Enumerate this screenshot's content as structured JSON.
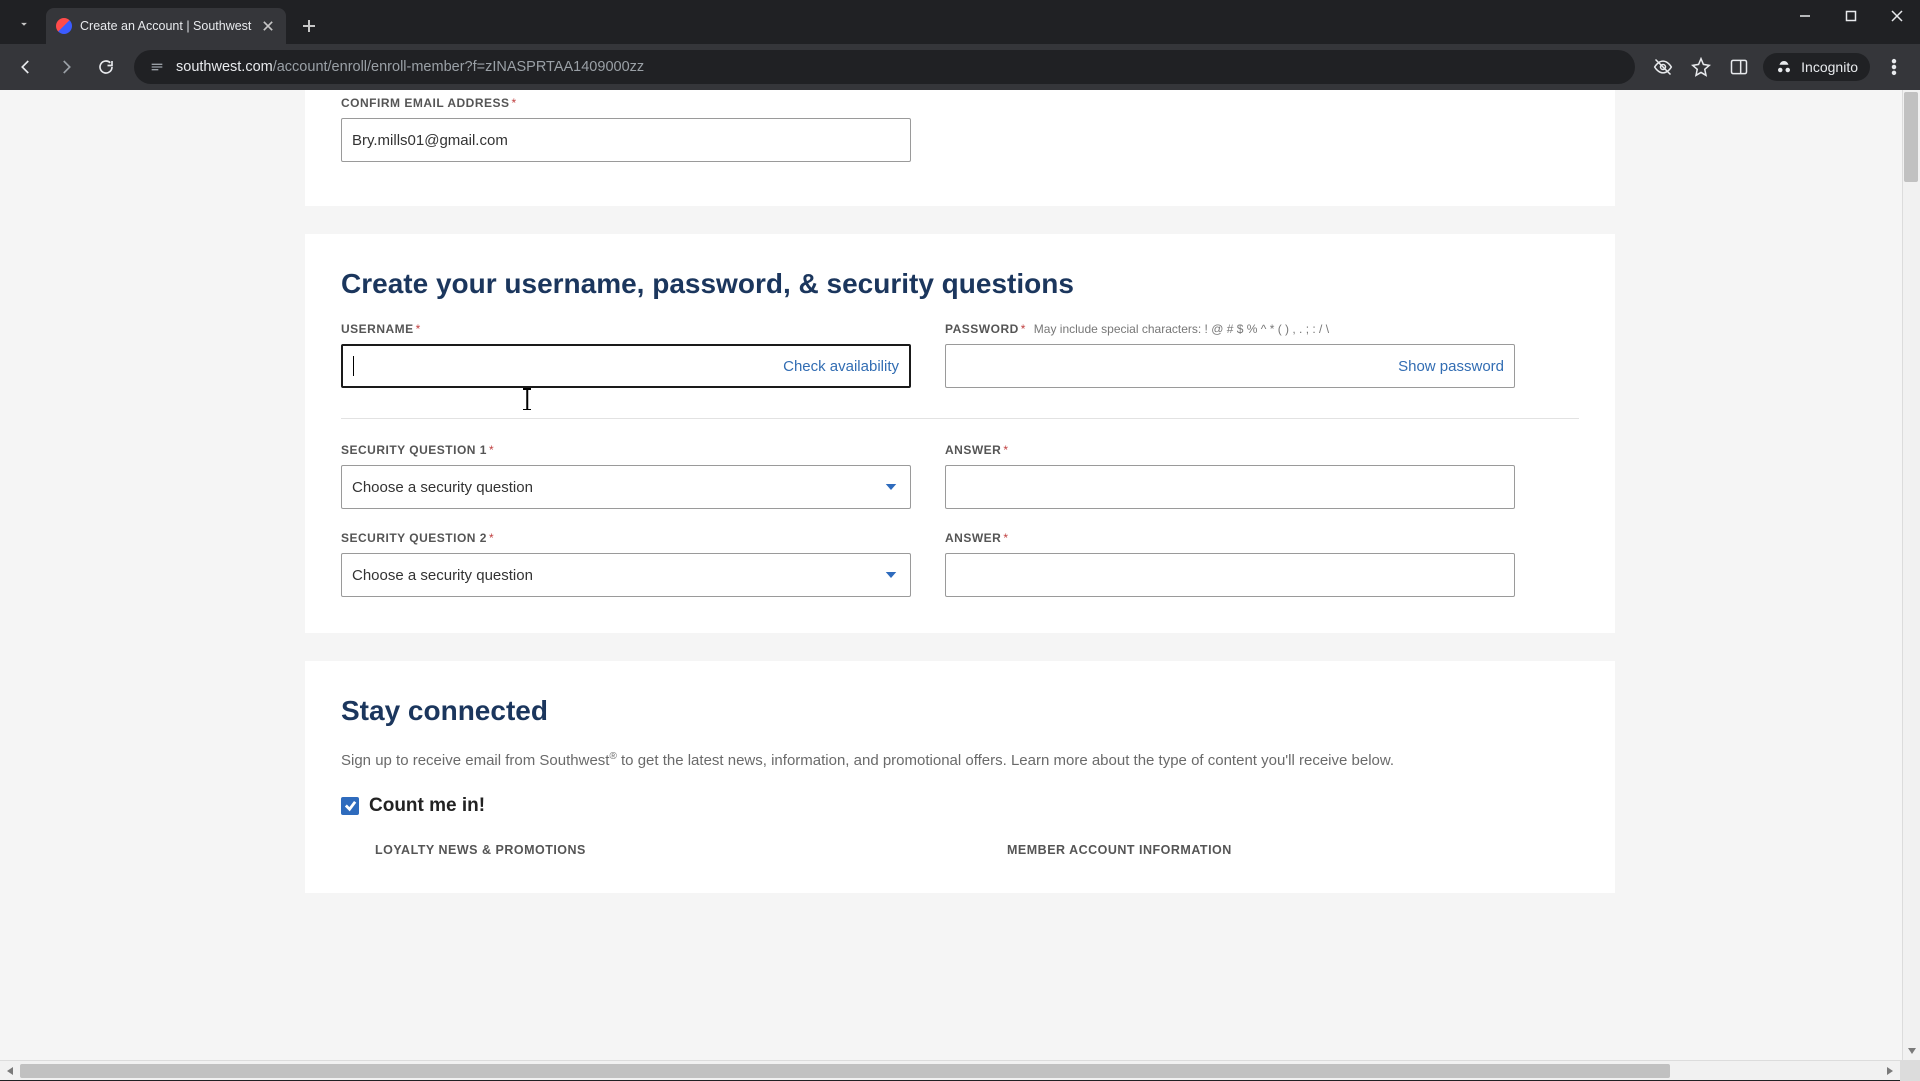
{
  "browser": {
    "tab_title": "Create an Account | Southwest",
    "url_display_domain": "southwest.com",
    "url_display_path": "/account/enroll/enroll-member?f=zINASPRTAA1409000zz",
    "incognito_label": "Incognito"
  },
  "email_section": {
    "confirm_label": "CONFIRM EMAIL ADDRESS",
    "confirm_value": "Bry.mills01@gmail.com"
  },
  "credentials_section": {
    "heading": "Create your username, password, & security questions",
    "username_label": "USERNAME",
    "username_value": "",
    "check_availability": "Check availability",
    "password_label": "PASSWORD",
    "password_hint": "May include special characters: ! @ # $ % ^ * ( ) , . ; : / \\",
    "password_value": "",
    "show_password": "Show password",
    "sq1_label": "SECURITY QUESTION 1",
    "sq1_selected": "Choose a security question",
    "sq2_label": "SECURITY QUESTION 2",
    "sq2_selected": "Choose a security question",
    "answer_label": "ANSWER",
    "answer1_value": "",
    "answer2_value": ""
  },
  "stay_section": {
    "heading": "Stay connected",
    "description_pre": "Sign up to receive email from Southwest",
    "description_post": " to get the latest news, information, and promotional offers. Learn more about the type of content you'll receive below.",
    "count_me_in": "Count me in!",
    "count_me_in_checked": true,
    "col1_head": "LOYALTY NEWS & PROMOTIONS",
    "col2_head": "MEMBER ACCOUNT INFORMATION"
  }
}
